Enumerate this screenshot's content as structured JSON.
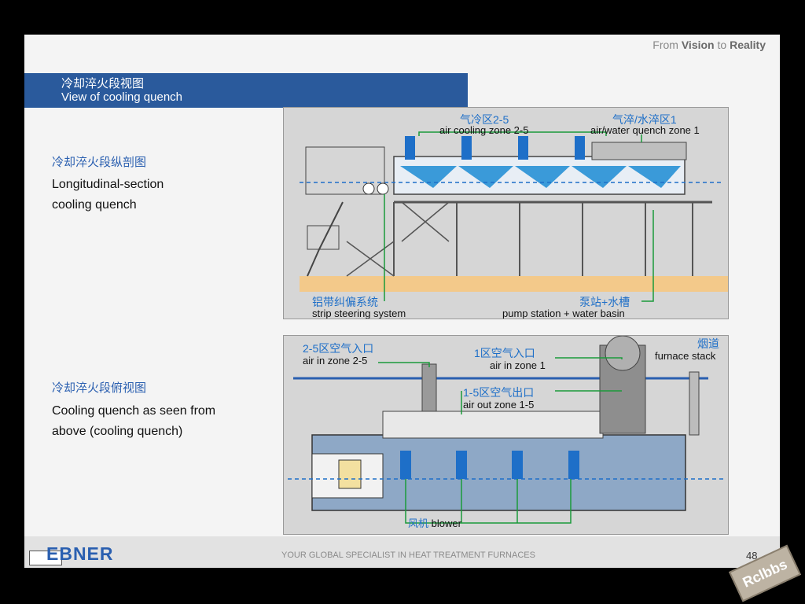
{
  "header": {
    "tagline_prefix": "From ",
    "tagline_vision": "Vision",
    "tagline_to": " to ",
    "tagline_reality": "Reality"
  },
  "title": {
    "zh": "冷却淬火段视图",
    "en": "View of cooling quench"
  },
  "sections": [
    {
      "label_zh": "冷却淬火段纵剖图",
      "label_en_line1": "Longitudinal-section",
      "label_en_line2": "cooling quench"
    },
    {
      "label_zh": "冷却淬火段俯视图",
      "label_en_line1": "Cooling quench as seen from",
      "label_en_line2": "above (cooling quench)"
    }
  ],
  "diagram_top": {
    "air_cooling_zh": "气冷区2-5",
    "air_cooling_en": "air cooling zone 2-5",
    "quench_zh": "气淬/水淬区1",
    "quench_en": "air/water quench zone 1",
    "steering_zh": "铝带纠偏系统",
    "steering_en": "strip steering system",
    "pump_zh": "泵站+水槽",
    "pump_en": "pump station + water basin"
  },
  "diagram_bottom": {
    "air_in_25_zh": "2-5区空气入口",
    "air_in_25_en": "air in zone 2-5",
    "air_in_1_zh": "1区空气入口",
    "air_in_1_en": "air in zone 1",
    "air_out_zh": "1-5区空气出口",
    "air_out_en": "air out zone 1-5",
    "stack_zh": "烟道",
    "stack_en": "furnace stack",
    "blower_zh": "风机",
    "blower_en": "blower"
  },
  "footer": {
    "logo": "EBNER",
    "slogan": "YOUR GLOBAL SPECIALIST IN HEAT TREATMENT FURNACES",
    "page_number": "48"
  },
  "watermark": "Rclbbs",
  "colors": {
    "title_bar": "#2a5a9c",
    "accent_blue": "#2a5fb0",
    "callout_green": "#1a9a3a",
    "equipment_blue": "#1e6fc8"
  }
}
